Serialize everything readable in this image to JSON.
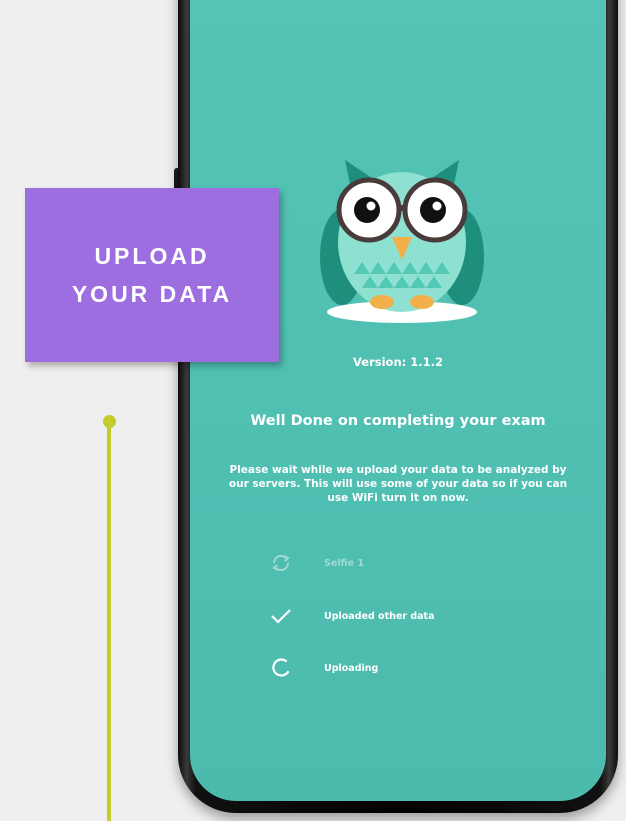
{
  "callout": {
    "line1": "UPLOAD",
    "line2": "YOUR DATA"
  },
  "app": {
    "mascot_icon": "owl-mascot-icon",
    "version": "Version: 1.1.2",
    "headline": "Well Done on completing your exam",
    "message": "Please wait while we upload your data to be analyzed by our servers. This will use some of your data so if you can use WiFi turn it on now.",
    "status_items": [
      {
        "icon": "sync-icon",
        "label": "Selfie 1",
        "state": "pending"
      },
      {
        "icon": "checkmark-icon",
        "label": "Uploaded other data",
        "state": "done"
      },
      {
        "icon": "spinner-icon",
        "label": "Uploading",
        "state": "in-progress"
      }
    ]
  },
  "colors": {
    "screen_background": "#4fbfb2",
    "callout_background": "#9d6ee0",
    "connector": "#c3cc2c",
    "owl_body": "#8ee0d0",
    "owl_wings": "#1f8f7d"
  }
}
